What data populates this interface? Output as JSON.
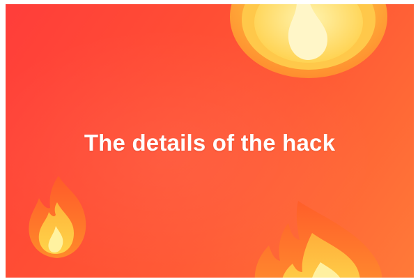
{
  "slide": {
    "headline": "The details of the hack"
  },
  "icons": {
    "top": "fire-icon",
    "left": "fire-icon",
    "bottom": "fire-icon"
  },
  "colors": {
    "background_start": "#ff3d3a",
    "background_end": "#ff7a38",
    "text": "#ffffff",
    "flame_outer": "#ff7a1e",
    "flame_mid": "#ffb12a",
    "flame_core": "#fff2a0"
  }
}
